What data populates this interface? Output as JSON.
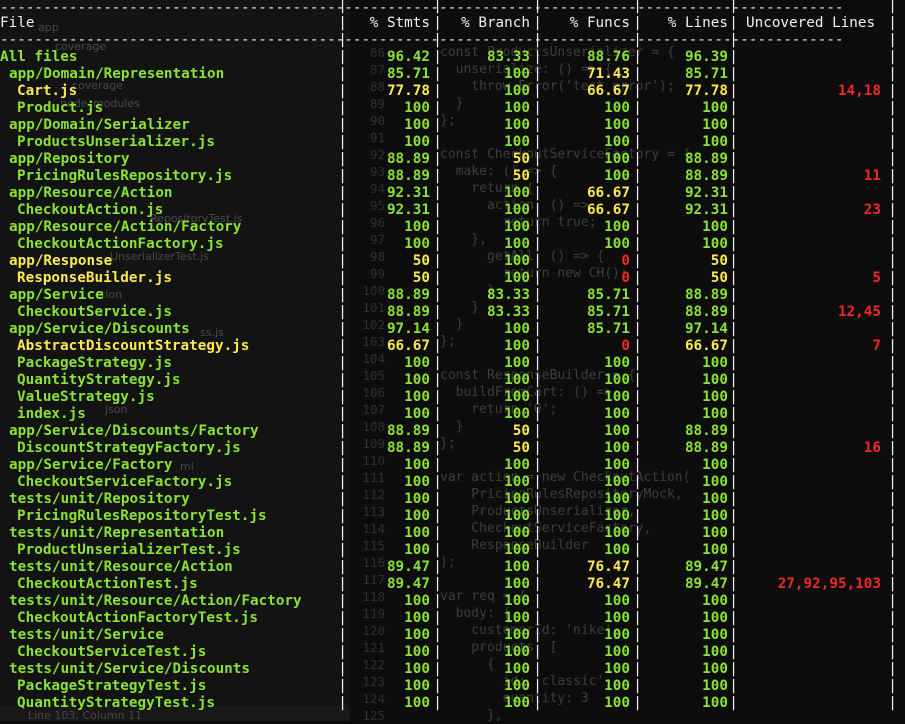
{
  "editor": {
    "sidebar_items": [
      "app",
      "coverage",
      "coverage",
      "node_modules",
      "RepositoryTest.js",
      "UnserializerTest.js",
      "ction",
      "ss.js",
      "json",
      "ml"
    ],
    "status_text": "Line 103, Column 11",
    "line_numbers": [
      86,
      87,
      88,
      89,
      90,
      91,
      92,
      93,
      94,
      95,
      96,
      97,
      98,
      99,
      100,
      101,
      102,
      103,
      104,
      105,
      106,
      107,
      108,
      109,
      110,
      111,
      112,
      113,
      114,
      115,
      116,
      117,
      118,
      119,
      120,
      121,
      122,
      123,
      124,
      125
    ],
    "code_lines": [
      "const ProductsUnserializer = {",
      "  unserialize: () => {",
      "    throw Error('test error');",
      "  }",
      "};",
      "",
      "const CheckoutServiceFactory = {",
      "  make: () => {",
      "    return {",
      "      action: () =>",
      "        return true;",
      "    },",
      "      getAll: () => {",
      "        return new CH();",
      "      }",
      "    }",
      "  }",
      "};",
      "",
      "const ResponseBuilder = {",
      "  buildFromCart: () =>",
      "    return '0';",
      "  }",
      "};",
      "",
      "var action = new CheckoutAction(",
      "    PricingRulesRepositoryMock,",
      "    ProductsUnserializer,",
      "    CheckoutServiceFactory,",
      "    ResponseBuilder",
      ");",
      "",
      "var req = {",
      "  body: {",
      "    customerId: 'nike',",
      "    products: [",
      "      {",
      "        id: 'classic',",
      "        quantity: 3",
      "      },"
    ]
  },
  "table": {
    "separator": "--------------------------------------------------------------------------------------------------",
    "headers": {
      "file": "File",
      "stmts": "% Stmts",
      "branch": "% Branch",
      "funcs": "% Funcs",
      "lines": "% Lines",
      "uncovered": "Uncovered Lines"
    },
    "rows": [
      {
        "file": "All files",
        "indent": 0,
        "stmts": "96.42",
        "branch": "83.33",
        "funcs": "88.76",
        "lines": "96.39",
        "uncovered": ""
      },
      {
        "file": "app/Domain/Representation",
        "indent": 1,
        "stmts": "85.71",
        "branch": "100",
        "funcs": "71.43",
        "lines": "85.71",
        "uncovered": ""
      },
      {
        "file": "Cart.js",
        "indent": 2,
        "stmts": "77.78",
        "branch": "100",
        "funcs": "66.67",
        "lines": "77.78",
        "uncovered": "14,18"
      },
      {
        "file": "Product.js",
        "indent": 2,
        "stmts": "100",
        "branch": "100",
        "funcs": "100",
        "lines": "100",
        "uncovered": ""
      },
      {
        "file": "app/Domain/Serializer",
        "indent": 1,
        "stmts": "100",
        "branch": "100",
        "funcs": "100",
        "lines": "100",
        "uncovered": ""
      },
      {
        "file": "ProductsUnserializer.js",
        "indent": 2,
        "stmts": "100",
        "branch": "100",
        "funcs": "100",
        "lines": "100",
        "uncovered": ""
      },
      {
        "file": "app/Repository",
        "indent": 1,
        "stmts": "88.89",
        "branch": "50",
        "funcs": "100",
        "lines": "88.89",
        "uncovered": ""
      },
      {
        "file": "PricingRulesRepository.js",
        "indent": 2,
        "stmts": "88.89",
        "branch": "50",
        "funcs": "100",
        "lines": "88.89",
        "uncovered": "11"
      },
      {
        "file": "app/Resource/Action",
        "indent": 1,
        "stmts": "92.31",
        "branch": "100",
        "funcs": "66.67",
        "lines": "92.31",
        "uncovered": ""
      },
      {
        "file": "CheckoutAction.js",
        "indent": 2,
        "stmts": "92.31",
        "branch": "100",
        "funcs": "66.67",
        "lines": "92.31",
        "uncovered": "23"
      },
      {
        "file": "app/Resource/Action/Factory",
        "indent": 1,
        "stmts": "100",
        "branch": "100",
        "funcs": "100",
        "lines": "100",
        "uncovered": ""
      },
      {
        "file": "CheckoutActionFactory.js",
        "indent": 2,
        "stmts": "100",
        "branch": "100",
        "funcs": "100",
        "lines": "100",
        "uncovered": ""
      },
      {
        "file": "app/Response",
        "indent": 1,
        "stmts": "50",
        "branch": "100",
        "funcs": "0",
        "lines": "50",
        "uncovered": ""
      },
      {
        "file": "ResponseBuilder.js",
        "indent": 2,
        "stmts": "50",
        "branch": "100",
        "funcs": "0",
        "lines": "50",
        "uncovered": "5"
      },
      {
        "file": "app/Service",
        "indent": 1,
        "stmts": "88.89",
        "branch": "83.33",
        "funcs": "85.71",
        "lines": "88.89",
        "uncovered": ""
      },
      {
        "file": "CheckoutService.js",
        "indent": 2,
        "stmts": "88.89",
        "branch": "83.33",
        "funcs": "85.71",
        "lines": "88.89",
        "uncovered": "12,45"
      },
      {
        "file": "app/Service/Discounts",
        "indent": 1,
        "stmts": "97.14",
        "branch": "100",
        "funcs": "85.71",
        "lines": "97.14",
        "uncovered": ""
      },
      {
        "file": "AbstractDiscountStrategy.js",
        "indent": 2,
        "stmts": "66.67",
        "branch": "100",
        "funcs": "0",
        "lines": "66.67",
        "uncovered": "7"
      },
      {
        "file": "PackageStrategy.js",
        "indent": 2,
        "stmts": "100",
        "branch": "100",
        "funcs": "100",
        "lines": "100",
        "uncovered": ""
      },
      {
        "file": "QuantityStrategy.js",
        "indent": 2,
        "stmts": "100",
        "branch": "100",
        "funcs": "100",
        "lines": "100",
        "uncovered": ""
      },
      {
        "file": "ValueStrategy.js",
        "indent": 2,
        "stmts": "100",
        "branch": "100",
        "funcs": "100",
        "lines": "100",
        "uncovered": ""
      },
      {
        "file": "index.js",
        "indent": 2,
        "stmts": "100",
        "branch": "100",
        "funcs": "100",
        "lines": "100",
        "uncovered": ""
      },
      {
        "file": "app/Service/Discounts/Factory",
        "indent": 1,
        "stmts": "88.89",
        "branch": "50",
        "funcs": "100",
        "lines": "88.89",
        "uncovered": ""
      },
      {
        "file": "DiscountStrategyFactory.js",
        "indent": 2,
        "stmts": "88.89",
        "branch": "50",
        "funcs": "100",
        "lines": "88.89",
        "uncovered": "16"
      },
      {
        "file": "app/Service/Factory",
        "indent": 1,
        "stmts": "100",
        "branch": "100",
        "funcs": "100",
        "lines": "100",
        "uncovered": ""
      },
      {
        "file": "CheckoutServiceFactory.js",
        "indent": 2,
        "stmts": "100",
        "branch": "100",
        "funcs": "100",
        "lines": "100",
        "uncovered": ""
      },
      {
        "file": "tests/unit/Repository",
        "indent": 1,
        "stmts": "100",
        "branch": "100",
        "funcs": "100",
        "lines": "100",
        "uncovered": ""
      },
      {
        "file": "PricingRulesRepositoryTest.js",
        "indent": 2,
        "stmts": "100",
        "branch": "100",
        "funcs": "100",
        "lines": "100",
        "uncovered": ""
      },
      {
        "file": "tests/unit/Representation",
        "indent": 1,
        "stmts": "100",
        "branch": "100",
        "funcs": "100",
        "lines": "100",
        "uncovered": ""
      },
      {
        "file": "ProductUnserializerTest.js",
        "indent": 2,
        "stmts": "100",
        "branch": "100",
        "funcs": "100",
        "lines": "100",
        "uncovered": ""
      },
      {
        "file": "tests/unit/Resource/Action",
        "indent": 1,
        "stmts": "89.47",
        "branch": "100",
        "funcs": "76.47",
        "lines": "89.47",
        "uncovered": ""
      },
      {
        "file": "CheckoutActionTest.js",
        "indent": 2,
        "stmts": "89.47",
        "branch": "100",
        "funcs": "76.47",
        "lines": "89.47",
        "uncovered": "27,92,95,103"
      },
      {
        "file": "tests/unit/Resource/Action/Factory",
        "indent": 1,
        "stmts": "100",
        "branch": "100",
        "funcs": "100",
        "lines": "100",
        "uncovered": ""
      },
      {
        "file": "CheckoutActionFactoryTest.js",
        "indent": 2,
        "stmts": "100",
        "branch": "100",
        "funcs": "100",
        "lines": "100",
        "uncovered": ""
      },
      {
        "file": "tests/unit/Service",
        "indent": 1,
        "stmts": "100",
        "branch": "100",
        "funcs": "100",
        "lines": "100",
        "uncovered": ""
      },
      {
        "file": "CheckoutServiceTest.js",
        "indent": 2,
        "stmts": "100",
        "branch": "100",
        "funcs": "100",
        "lines": "100",
        "uncovered": ""
      },
      {
        "file": "tests/unit/Service/Discounts",
        "indent": 1,
        "stmts": "100",
        "branch": "100",
        "funcs": "100",
        "lines": "100",
        "uncovered": ""
      },
      {
        "file": "PackageStrategyTest.js",
        "indent": 2,
        "stmts": "100",
        "branch": "100",
        "funcs": "100",
        "lines": "100",
        "uncovered": ""
      },
      {
        "file": "QuantityStrategyTest.js",
        "indent": 2,
        "stmts": "100",
        "branch": "100",
        "funcs": "100",
        "lines": "100",
        "uncovered": ""
      }
    ],
    "colors": {
      "high": "#8ae234",
      "medium": "#fce94f",
      "low": "#ef2929"
    }
  }
}
